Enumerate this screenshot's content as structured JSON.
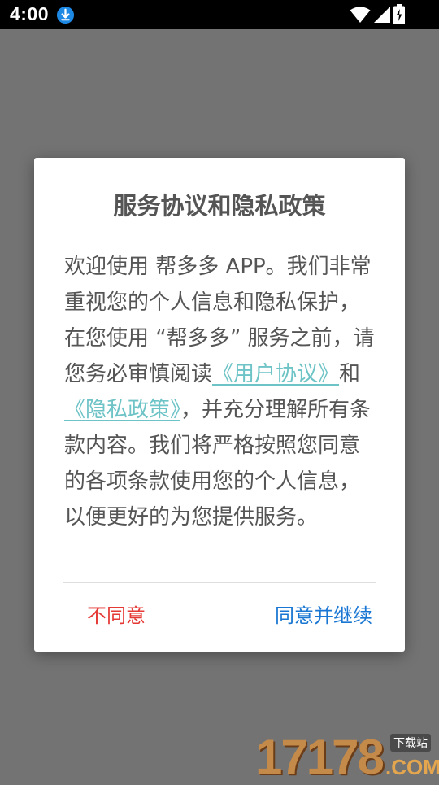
{
  "status_bar": {
    "time": "4:00",
    "icons": [
      "download-icon",
      "wifi-icon",
      "signal-icon",
      "battery-icon"
    ]
  },
  "dialog": {
    "title": "服务协议和隐私政策",
    "body": {
      "part1": "欢迎使用 帮多多 APP。我们非常重视您的个人信息和隐私保护，在您使用 “帮多多” 服务之前，请您务必审慎阅读",
      "user_agreement_link": "《用户协议》",
      "connector": "和",
      "privacy_policy_link": "《隐私政策》",
      "part2": "，并充分理解所有条款内容。我们将严格按照您同意的各项条款使用您的个人信息，以便更好的为您提供服务。"
    },
    "disagree_label": "不同意",
    "agree_label": "同意并继续"
  },
  "watermark": {
    "digits": "17178",
    "sub": "下载站",
    "suffix": ".COM"
  },
  "colors": {
    "overlay": "#737373",
    "link": "#6ec3c6",
    "disagree": "#e53935",
    "agree": "#1976d2"
  }
}
